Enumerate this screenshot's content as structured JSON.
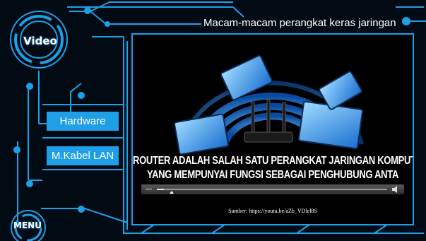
{
  "header": {
    "title": "Macam-macam perangkat keras jaringan"
  },
  "badges": {
    "video_label": "Video",
    "menu_label": "MENU"
  },
  "sidebar": {
    "buttons": [
      {
        "label": "Hardware"
      },
      {
        "label": "M.Kabel LAN"
      }
    ]
  },
  "video": {
    "caption_line1": "ROUTER ADALAH SALAH SATU PERANGKAT JARINGAN KOMPUTER",
    "caption_line2": "YANG MEMPUNYAI FUNGSI SEBAGAI PENGHUBUNG ANTA",
    "source_text": "Sumber: https://youtu.be/aZb_VDlel8S",
    "progress_fraction": 0.03,
    "icons": {
      "play": "play-icon",
      "volume": "volume-icon"
    }
  },
  "colors": {
    "accent": "#1e9fe6",
    "background": "#020b14"
  }
}
